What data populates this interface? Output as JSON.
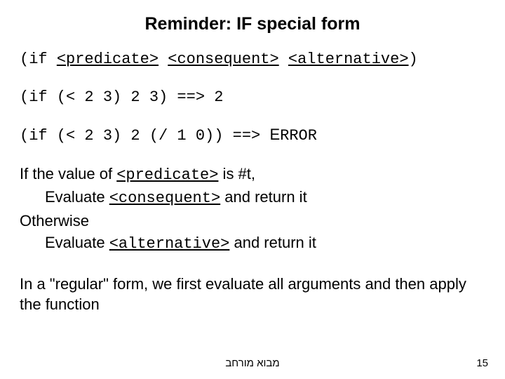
{
  "title": "Reminder: IF special form",
  "syntax": {
    "open": "(if ",
    "pred": "<predicate>",
    "sp1": " ",
    "cons": "<consequent>",
    "sp2": " ",
    "alt": "<alternative>",
    "close": ")"
  },
  "ex1": {
    "expr": "(if (< 2 3) 2 3) ==>  ",
    "result": "2"
  },
  "ex2": {
    "expr": "(if (< 2 3) 2 (/ 1 0)) ==>   ",
    "result_prefix": "E",
    "result_rest": "RROR"
  },
  "body": {
    "l1a": "If the value of ",
    "l1b": "<predicate>",
    "l1c": " is #t,",
    "l2a": "Evaluate ",
    "l2b": "<consequent>",
    "l2c": " and return it",
    "l3": "Otherwise",
    "l4a": "Evaluate ",
    "l4b": "<alternative>",
    "l4c": " and return it"
  },
  "closing": "In a \"regular\" form, we first evaluate all arguments and then apply the function",
  "footer_hebrew": "מבוא מורחב",
  "page_number": "15"
}
